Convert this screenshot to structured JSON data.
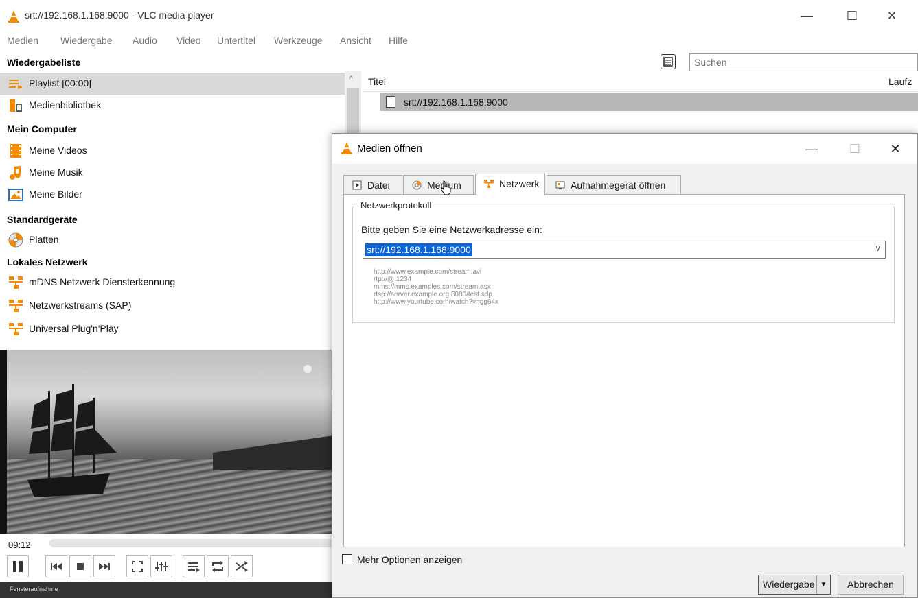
{
  "window": {
    "title": "srt://192.168.1.168:9000 - VLC media player",
    "controls": {
      "minimize": "—",
      "maximize": "☐",
      "close": "✕"
    }
  },
  "menu": [
    "Medien",
    "Wiedergabe",
    "Audio",
    "Video",
    "Untertitel",
    "Werkzeuge",
    "Ansicht",
    "Hilfe"
  ],
  "sidebar": {
    "header": "Wiedergabeliste",
    "items": [
      {
        "label": "Playlist [00:00]",
        "icon": "playlist-icon"
      },
      {
        "label": "Medienbibliothek",
        "icon": "media-library-icon"
      }
    ],
    "sections": [
      {
        "title": "Mein Computer",
        "items": [
          {
            "label": "Meine Videos",
            "icon": "film-icon"
          },
          {
            "label": "Meine Musik",
            "icon": "music-note-icon"
          },
          {
            "label": "Meine Bilder",
            "icon": "picture-icon"
          }
        ]
      },
      {
        "title": "Standardgeräte",
        "items": [
          {
            "label": "Platten",
            "icon": "disc-icon"
          }
        ]
      },
      {
        "title": "Lokales Netzwerk",
        "items": [
          {
            "label": "mDNS Netzwerk Diensterkennung",
            "icon": "network-icon"
          },
          {
            "label": "Netzwerkstreams (SAP)",
            "icon": "network-icon"
          },
          {
            "label": "Universal Plug'n'Play",
            "icon": "network-icon"
          }
        ]
      }
    ]
  },
  "playlist": {
    "search_placeholder": "Suchen",
    "columns": [
      "Titel",
      "Laufz"
    ],
    "rows": [
      {
        "title": "srt://192.168.1.168:9000"
      }
    ]
  },
  "player": {
    "time": "09:12",
    "bottom_strip": "Fensteraufnahme"
  },
  "dialog": {
    "title": "Medien öffnen",
    "controls": {
      "minimize": "—",
      "maximize": "☐",
      "close": "✕"
    },
    "tabs": [
      {
        "label": "Datei",
        "icon": "file-play-icon",
        "active": false
      },
      {
        "label": "Medium",
        "icon": "disc-icon",
        "active": false
      },
      {
        "label": "Netzwerk",
        "icon": "network-icon",
        "active": true
      },
      {
        "label": "Aufnahmegerät öffnen",
        "icon": "capture-device-icon",
        "active": false
      }
    ],
    "group_title": "Netzwerkprotokoll",
    "prompt": "Bitte geben Sie eine Netzwerkadresse ein:",
    "url_value": "srt://192.168.1.168:9000",
    "examples": [
      "http://www.example.com/stream.avi",
      "rtp://@:1234",
      "mms://mms.examples.com/stream.asx",
      "rtsp://server.example.org:8080/test.sdp",
      "http://www.yourtube.com/watch?v=gg64x"
    ],
    "more_options": "Mehr Optionen anzeigen",
    "play_button": "Wiedergabe",
    "cancel_button": "Abbrechen"
  },
  "colors": {
    "accent": "#0a64d6",
    "vlc_orange": "#f48b00",
    "selection": "#d9d9d9"
  }
}
